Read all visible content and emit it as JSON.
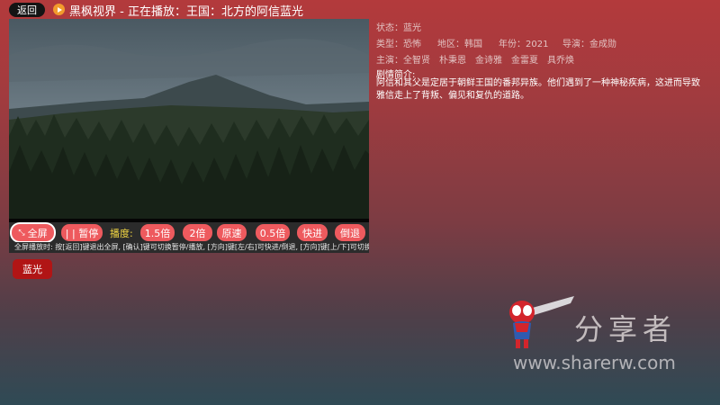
{
  "header": {
    "back_label": "返回",
    "title": "黑枫视界 - 正在播放：王国：北方的阿信蓝光"
  },
  "controls": {
    "fullscreen_label": "全屏",
    "pause_label": "| | 暂停",
    "speed_label": "播度:",
    "speeds": [
      "1.5倍",
      "2倍",
      "原速",
      "0.5倍"
    ],
    "forward_label": "快进",
    "rewind_label": "倒退",
    "hint": "全屏播放时: 按[返回]键退出全屏, [确认]键可切换暂停/播放, [方向]键[左/右]可快进/倒退, [方向]键[上/下]可切换倍速"
  },
  "source_label": "蓝光",
  "info": {
    "status": "状态：蓝光",
    "type": "类型：恐怖",
    "region": "地区：韩国",
    "year": "年份：2021",
    "director": "导演：金成勋",
    "cast_label": "主演：",
    "cast": [
      "全智贤",
      "朴秉恩",
      "金诗雅",
      "金雷夏",
      "具乔焕"
    ],
    "synopsis_label": "剧情简介:",
    "synopsis": "阿信和其父是定居于朝鲜王国的番邦异族。他们遇到了一种神秘疾病，这进而导致雅信走上了背叛、偏见和复仇的道路。"
  },
  "watermark": {
    "text": "分享者",
    "url": "www.sharerw.com"
  }
}
